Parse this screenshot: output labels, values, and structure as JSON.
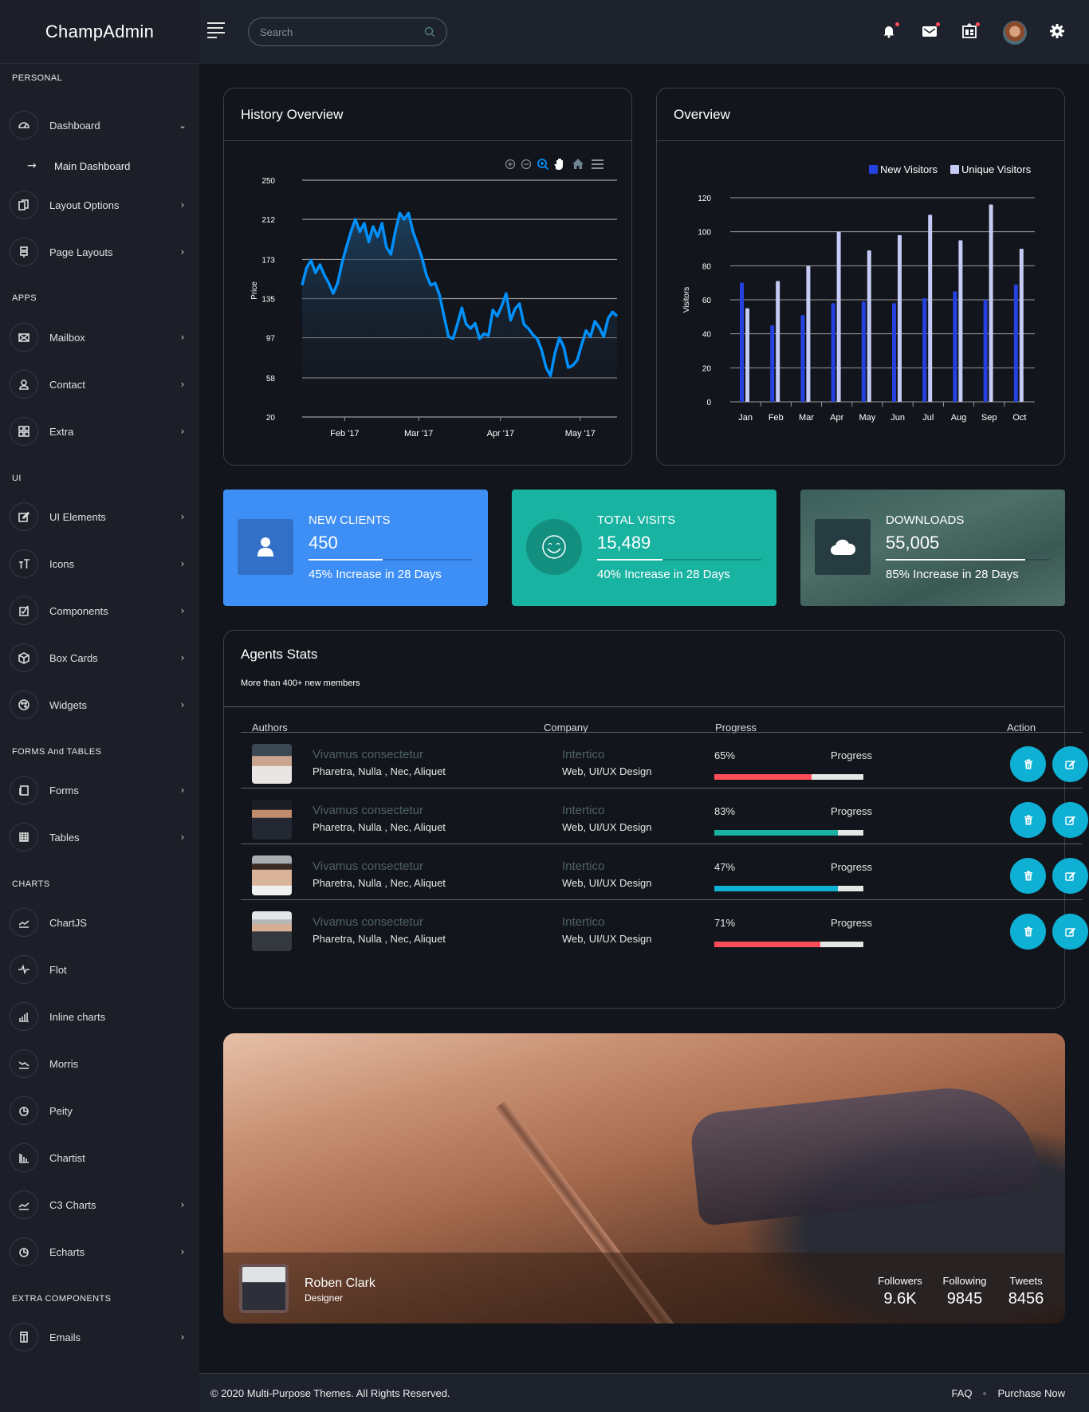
{
  "brand": "ChampAdmin",
  "search": {
    "placeholder": "Search"
  },
  "topbar": {
    "icons": [
      "notification-bell-icon",
      "mail-icon",
      "calendar-icon",
      "user-avatar",
      "settings-gear-icon"
    ],
    "badges": {
      "notifications": true,
      "mail": true,
      "calendar": true
    }
  },
  "sidebar": {
    "sections": [
      {
        "header": "PERSONAL",
        "items": [
          {
            "label": "Dashboard",
            "icon": "dashboard-gauge-icon",
            "expanded": true,
            "sub": [
              {
                "label": "Main Dashboard"
              }
            ]
          },
          {
            "label": "Layout Options",
            "icon": "layout-copy-icon"
          },
          {
            "label": "Page Layouts",
            "icon": "signpost-icon"
          }
        ]
      },
      {
        "header": "APPS",
        "items": [
          {
            "label": "Mailbox",
            "icon": "envelope-icon"
          },
          {
            "label": "Contact",
            "icon": "user-icon"
          },
          {
            "label": "Extra",
            "icon": "grid-icon"
          }
        ]
      },
      {
        "header": "UI",
        "items": [
          {
            "label": "UI Elements",
            "icon": "edit-square-icon"
          },
          {
            "label": "Icons",
            "icon": "text-size-icon"
          },
          {
            "label": "Components",
            "icon": "checkbox-icon"
          },
          {
            "label": "Box Cards",
            "icon": "box-icon"
          },
          {
            "label": "Widgets",
            "icon": "palette-icon"
          }
        ]
      },
      {
        "header": "FORMS And TABLES",
        "items": [
          {
            "label": "Forms",
            "icon": "forms-copy-icon"
          },
          {
            "label": "Tables",
            "icon": "table-icon"
          }
        ]
      },
      {
        "header": "CHARTS",
        "items": [
          {
            "label": "ChartJS",
            "icon": "trend-up-icon",
            "arrow": false
          },
          {
            "label": "Flot",
            "icon": "pulse-icon",
            "arrow": false
          },
          {
            "label": "Inline charts",
            "icon": "bar-chart-icon",
            "arrow": false
          },
          {
            "label": "Morris",
            "icon": "trend-down-icon",
            "arrow": false
          },
          {
            "label": "Peity",
            "icon": "pie-chart-icon",
            "arrow": false
          },
          {
            "label": "Chartist",
            "icon": "column-chart-icon",
            "arrow": false
          },
          {
            "label": "C3 Charts",
            "icon": "trend-up-icon",
            "arrow": true
          },
          {
            "label": "Echarts",
            "icon": "pie-chart-icon",
            "arrow": true
          }
        ]
      },
      {
        "header": "EXTRA COMPONENTS",
        "items": [
          {
            "label": "Emails",
            "icon": "email-template-icon",
            "arrow": true
          }
        ]
      }
    ]
  },
  "history_card": {
    "title": "History Overview",
    "toolbar": [
      "zoom-in-icon",
      "zoom-out-icon",
      "selection-zoom-icon",
      "pan-hand-icon",
      "reset-home-icon",
      "menu-icon"
    ]
  },
  "overview_card": {
    "title": "Overview"
  },
  "chart_data": [
    {
      "type": "area",
      "title": "History Overview",
      "ylabel": "Price",
      "xlabel": "",
      "y_ticks": [
        20,
        58,
        97,
        135,
        173,
        212,
        250
      ],
      "ylim": [
        20,
        250
      ],
      "x_ticks": [
        "Feb '17",
        "Mar '17",
        "Apr '17",
        "May '17"
      ],
      "x_tick_positions": [
        0.135,
        0.37,
        0.63,
        0.883
      ],
      "grid": true,
      "series": [
        {
          "name": "Price",
          "color": "#008ffb",
          "values": [
            148,
            165,
            172,
            160,
            168,
            158,
            150,
            140,
            150,
            170,
            185,
            200,
            212,
            200,
            208,
            190,
            205,
            195,
            208,
            185,
            178,
            200,
            218,
            212,
            218,
            200,
            188,
            175,
            158,
            148,
            150,
            138,
            118,
            98,
            96,
            110,
            126,
            110,
            106,
            111,
            96,
            101,
            99,
            124,
            118,
            128,
            140,
            114,
            125,
            130,
            110,
            106,
            100,
            96,
            85,
            68,
            60,
            82,
            97,
            88,
            68,
            70,
            75,
            90,
            104,
            98,
            113,
            107,
            98,
            116,
            122,
            118
          ]
        }
      ]
    },
    {
      "type": "bar",
      "title": "Overview",
      "ylabel": "Visitors",
      "categories": [
        "Jan",
        "Feb",
        "Mar",
        "Apr",
        "May",
        "Jun",
        "Jul",
        "Aug",
        "Sep",
        "Oct"
      ],
      "ylim": [
        0,
        120
      ],
      "y_ticks": [
        0,
        20,
        40,
        60,
        80,
        100,
        120
      ],
      "grid": true,
      "legend": "top-right",
      "series": [
        {
          "name": "New Visitors",
          "color": "#2541e0",
          "values": [
            70,
            45,
            51,
            58,
            59,
            58,
            61,
            65,
            60,
            69
          ]
        },
        {
          "name": "Unique Visitors",
          "color": "#c5cbf5",
          "values": [
            55,
            71,
            80,
            100,
            89,
            98,
            110,
            95,
            116,
            90
          ]
        }
      ]
    }
  ],
  "stats": [
    {
      "title": "NEW CLIENTS",
      "value": "450",
      "progress": 45,
      "desc": "45% Increase in 28 Days",
      "icon": "user-icon",
      "color": "#3d8ef5"
    },
    {
      "title": "TOTAL VISITS",
      "value": "15,489",
      "progress": 40,
      "desc": "40% Increase in 28 Days",
      "icon": "smiley-icon",
      "color": "#19b3a2"
    },
    {
      "title": "DOWNLOADS",
      "value": "55,005",
      "progress": 85,
      "desc": "85% Increase in 28 Days",
      "icon": "cloud-icon",
      "color": "#3f5f5a"
    }
  ],
  "agents": {
    "title": "Agents Stats",
    "subtitle": "More than 400+ new members",
    "columns": [
      "Authors",
      "Company",
      "Progress",
      "Action"
    ],
    "rows": [
      {
        "name": "Vivamus consectetur",
        "tags": "Pharetra, Nulla , Nec, Aliquet",
        "company": "Intertico",
        "dept": "Web, UI/UX Design",
        "pct_label": "65%",
        "progress": 65,
        "progress_label": "Progress",
        "color": "#ff4d5a"
      },
      {
        "name": "Vivamus consectetur",
        "tags": "Pharetra, Nulla , Nec, Aliquet",
        "company": "Intertico",
        "dept": "Web, UI/UX Design",
        "pct_label": "83%",
        "progress": 83,
        "progress_label": "Progress",
        "color": "#19b3a2"
      },
      {
        "name": "Vivamus consectetur",
        "tags": "Pharetra, Nulla , Nec, Aliquet",
        "company": "Intertico",
        "dept": "Web, UI/UX Design",
        "pct_label": "47%",
        "progress": 83,
        "progress_label": "Progress",
        "color": "#0eb0d4"
      },
      {
        "name": "Vivamus consectetur",
        "tags": "Pharetra, Nulla , Nec, Aliquet",
        "company": "Intertico",
        "dept": "Web, UI/UX Design",
        "pct_label": "71%",
        "progress": 71,
        "progress_label": "Progress",
        "color": "#ff4d5a"
      }
    ],
    "actions": [
      "delete-trash-icon",
      "edit-icon"
    ]
  },
  "profile": {
    "name": "Roben Clark",
    "role": "Designer",
    "stats": [
      {
        "label": "Followers",
        "value": "9.6K"
      },
      {
        "label": "Following",
        "value": "9845"
      },
      {
        "label": "Tweets",
        "value": "8456"
      }
    ]
  },
  "footer": {
    "copyright": "© 2020 Multi-Purpose Themes. All Rights Reserved.",
    "links": [
      "FAQ",
      "Purchase Now"
    ]
  }
}
